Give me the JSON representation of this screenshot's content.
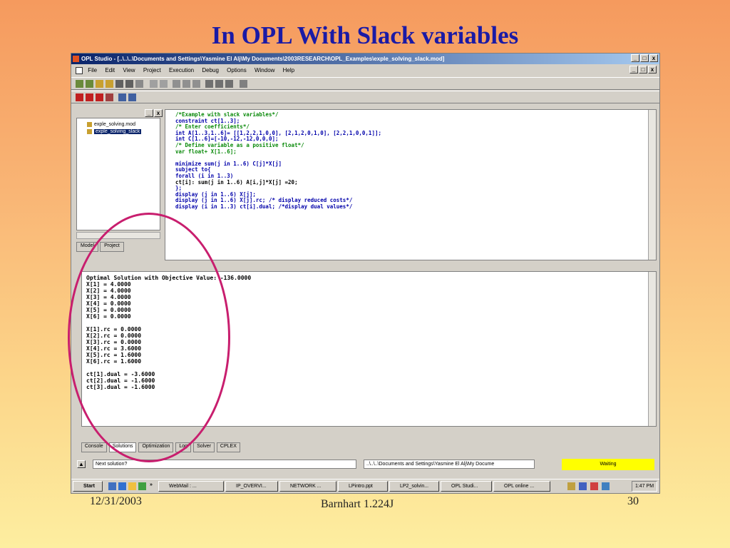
{
  "slide": {
    "title": "In OPL With Slack variables",
    "footer_date": "12/31/2003",
    "footer_center": "Barnhart 1.224J",
    "footer_page": "30",
    "highlight_color": "#c81e6e"
  },
  "window": {
    "title": "OPL Studio - [..\\..\\..\\Documents and Settings\\Yasmine El Alj\\My Documents\\2003RESEARCH\\OPL_Examples\\exple_solving_slack.mod]",
    "min_label": "_",
    "max_label": "□",
    "close_label": "x"
  },
  "menu": [
    "File",
    "Edit",
    "View",
    "Project",
    "Execution",
    "Debug",
    "Options",
    "Window",
    "Help"
  ],
  "project": {
    "items": [
      "exple_solving.mod",
      "exple_solving_slack"
    ],
    "tabs": [
      "Model",
      "Project"
    ]
  },
  "editor": {
    "lines": [
      {
        "t": "/*Example with slack variables*/",
        "k": "c"
      },
      {
        "t": "constraint ct[1..3];",
        "k": "k"
      },
      {
        "t": "/* Enter coefficients*/",
        "k": "c"
      },
      {
        "t": "int A[1..3,1..6]= [[1,2,2,1,0,0], [2,1,2,0,1,0], [2,2,1,0,0,1]];",
        "k": "k"
      },
      {
        "t": "int C[1..6]=[-10,-12,-12,0,0,0];",
        "k": "k"
      },
      {
        "t": "/* Define variable as a positive float*/",
        "k": "c"
      },
      {
        "t": "var float+ X[1..6];",
        "k": "c"
      },
      {
        "t": "",
        "k": ""
      },
      {
        "t": "minimize sum(j in 1..6) C[j]*X[j]",
        "k": "k"
      },
      {
        "t": "subject to{",
        "k": "k"
      },
      {
        "t": "forall (i in 1..3)",
        "k": "k"
      },
      {
        "t": "ct[i]: sum(j in 1..6) A[i,j]*X[j] =20;",
        "k": ""
      },
      {
        "t": "};",
        "k": "k"
      },
      {
        "t": "display (j in 1..6) X[j];",
        "k": "k"
      },
      {
        "t": "display (j in 1..6) X[j].rc; /* display reduced costs*/",
        "k": "k"
      },
      {
        "t": "display (i in 1..3) ct[i].dual; /*display dual values*/",
        "k": "k"
      }
    ]
  },
  "output": {
    "lines": [
      "Optimal Solution with Objective Value: -136.0000",
      "X[1] = 4.0000",
      "X[2] = 4.0000",
      "X[3] = 4.0000",
      "X[4] = 0.0000",
      "X[5] = 0.0000",
      "X[6] = 0.0000",
      "",
      "X[1].rc = 0.0000",
      "X[2].rc = 0.0000",
      "X[3].rc = 0.0000",
      "X[4].rc = 3.6000",
      "X[5].rc = 1.6000",
      "X[6].rc = 1.6000",
      "",
      "ct[1].dual = -3.6000",
      "ct[2].dual = -1.6000",
      "ct[3].dual = -1.6000"
    ],
    "tabs": [
      "Console",
      "Solutions",
      "Optimization",
      "Log",
      "Solver",
      "CPLEX"
    ]
  },
  "status": {
    "field": "Next solution?",
    "path": "..\\..\\..\\Documents and Settings\\Yasmine El Alj\\My Docume",
    "state": "Waiting",
    "state_color": "#ffff00"
  },
  "taskbar": {
    "start": "Start",
    "quicklaunch": "»",
    "tasks": [
      "WebMail : ...",
      "IP_OVERVI...",
      "NETWORK ...",
      "LPintro.ppt",
      "LP2_solvin...",
      "OPL Studi...",
      "OPL online ..."
    ],
    "clock": "1:47 PM"
  }
}
